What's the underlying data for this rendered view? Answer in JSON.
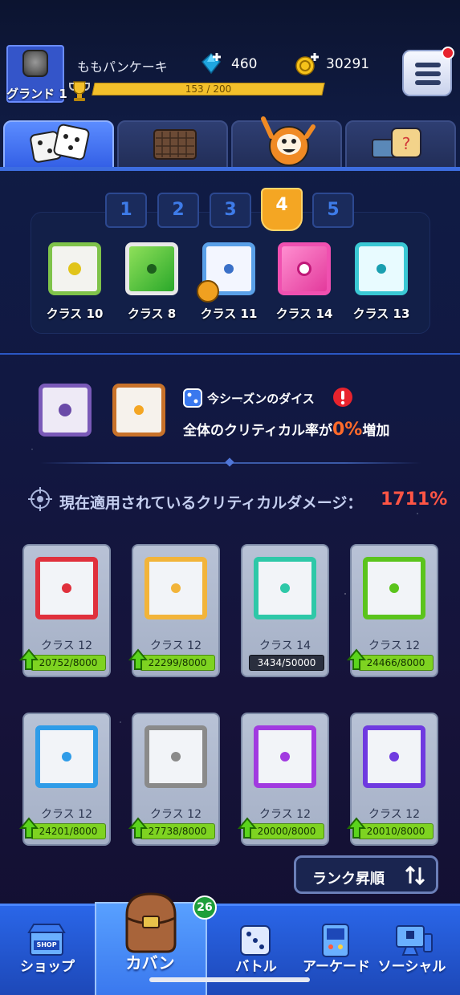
{
  "header": {
    "username": "ももパンケーキ",
    "rank": "グランド 1",
    "gems": "460",
    "coins": "30291",
    "xp_text": "153 / 200"
  },
  "tabs": [
    "dice-tab",
    "board-tab",
    "emote-tab",
    "item-tab"
  ],
  "deck": {
    "numbers": [
      "1",
      "2",
      "3",
      "4",
      "5"
    ],
    "active_index": 3,
    "dice": [
      {
        "label": "クラス 10",
        "color": "#7fc34a"
      },
      {
        "label": "クラス 8",
        "color": "#3fbf3f"
      },
      {
        "label": "クラス 11",
        "color": "#5aa0e8"
      },
      {
        "label": "クラス 14",
        "color": "#ea3fa0"
      },
      {
        "label": "クラス 13",
        "color": "#3ac8d4"
      }
    ]
  },
  "season": {
    "title": "今シーズンのダイス",
    "sub_prefix": "全体のクリティカル率が",
    "sub_pct": "0%",
    "sub_suffix": "増加"
  },
  "crit": {
    "label": "現在適用されているクリティカルダメージ：",
    "value": "1711%"
  },
  "cards": [
    {
      "label": "クラス 12",
      "progress": "20752/8000",
      "color": "#e0303c",
      "upgradable": true
    },
    {
      "label": "クラス 12",
      "progress": "22299/8000",
      "color": "#f2b43a",
      "upgradable": true
    },
    {
      "label": "クラス 14",
      "progress": "3434/50000",
      "color": "#2ec8a8",
      "upgradable": false
    },
    {
      "label": "クラス 12",
      "progress": "24466/8000",
      "color": "#5bc41c",
      "upgradable": true
    },
    {
      "label": "クラス 12",
      "progress": "24201/8000",
      "color": "#2f9ce8",
      "upgradable": true
    },
    {
      "label": "クラス 12",
      "progress": "27738/8000",
      "color": "#8a8a8a",
      "upgradable": true
    },
    {
      "label": "クラス 12",
      "progress": "20000/8000",
      "color": "#a13ae0",
      "upgradable": true
    },
    {
      "label": "クラス 12",
      "progress": "20010/8000",
      "color": "#6f3ae0",
      "upgradable": true
    }
  ],
  "sort_label": "ランク昇順",
  "nav": {
    "shop": "ショップ",
    "bag": "カバン",
    "battle": "バトル",
    "arcade": "アーケード",
    "social": "ソーシャル",
    "bag_badge": "26",
    "shop_sign": "SHOP"
  }
}
